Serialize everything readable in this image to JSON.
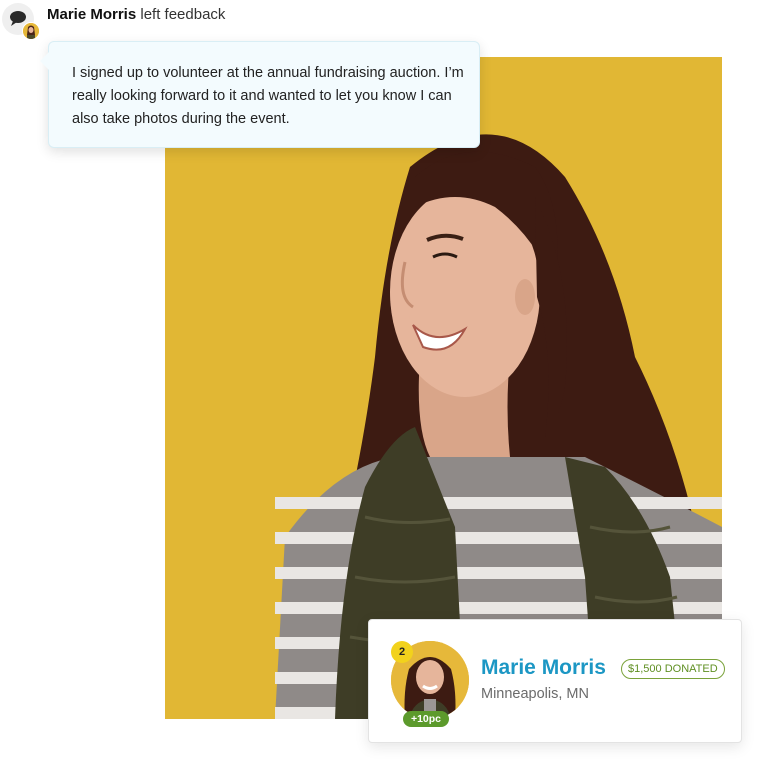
{
  "feedback": {
    "author_name": "Marie Morris",
    "action_text": "left feedback",
    "message": "I signed up to volunteer at the annual fundraising auction. I’m really looking forward to it and wanted to let you know I can also take photos during the event.",
    "icon": "speech-bubble-icon"
  },
  "profile_card": {
    "name": "Marie Morris",
    "donated_label": "$1,500 DONATED",
    "location": "Minneapolis, MN",
    "rank": "2",
    "points": "+10pc"
  },
  "colors": {
    "photo_background": "#e1b734",
    "name_accent": "#1c97c4",
    "donated_badge": "#7aa23a",
    "points_badge": "#5c9a2c",
    "rank_badge": "#f2d21c",
    "bubble_background": "#f3fbfe"
  }
}
